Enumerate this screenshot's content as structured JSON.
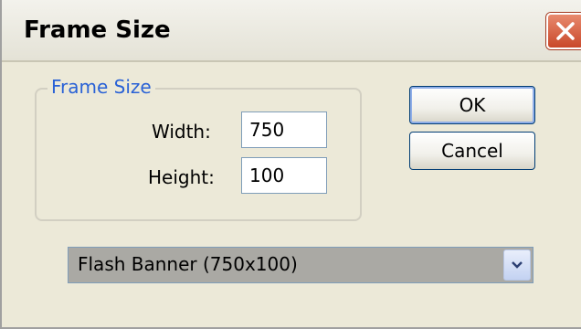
{
  "window": {
    "title": "Frame Size",
    "close_icon": "close-icon"
  },
  "group": {
    "legend": "Frame Size",
    "width_label": "Width:",
    "width_value": "750",
    "height_label": "Height:",
    "height_value": "100"
  },
  "buttons": {
    "ok_label": "OK",
    "cancel_label": "Cancel"
  },
  "preset": {
    "selected": "Flash Banner (750x100)",
    "dropdown_icon": "chevron-down-icon"
  },
  "colors": {
    "close_button": "#d2553a",
    "legend_text": "#2a62d6",
    "dialog_background": "#ece9d8"
  }
}
